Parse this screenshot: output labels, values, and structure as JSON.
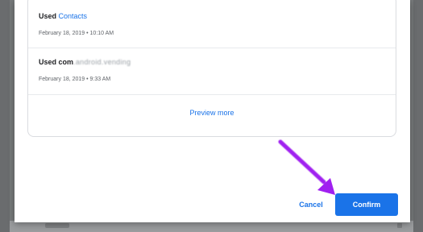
{
  "activities": [
    {
      "prefix": "Used",
      "app": "Contacts",
      "time": "February 18, 2019 • 10:10 AM"
    },
    {
      "prefix": "Used",
      "app": "com.android.vending",
      "visible_title": "Used com...",
      "time": "February 18, 2019 • 9:33 AM"
    }
  ],
  "preview_more_label": "Preview more",
  "buttons": {
    "cancel_label": "Cancel",
    "confirm_label": "Confirm"
  },
  "colors": {
    "accent": "#1a73e8",
    "annotation_arrow": "#a020f0",
    "backdrop": "#777a7b"
  },
  "annotation": {
    "icon": "arrow-icon",
    "points_to": "confirm-button"
  }
}
